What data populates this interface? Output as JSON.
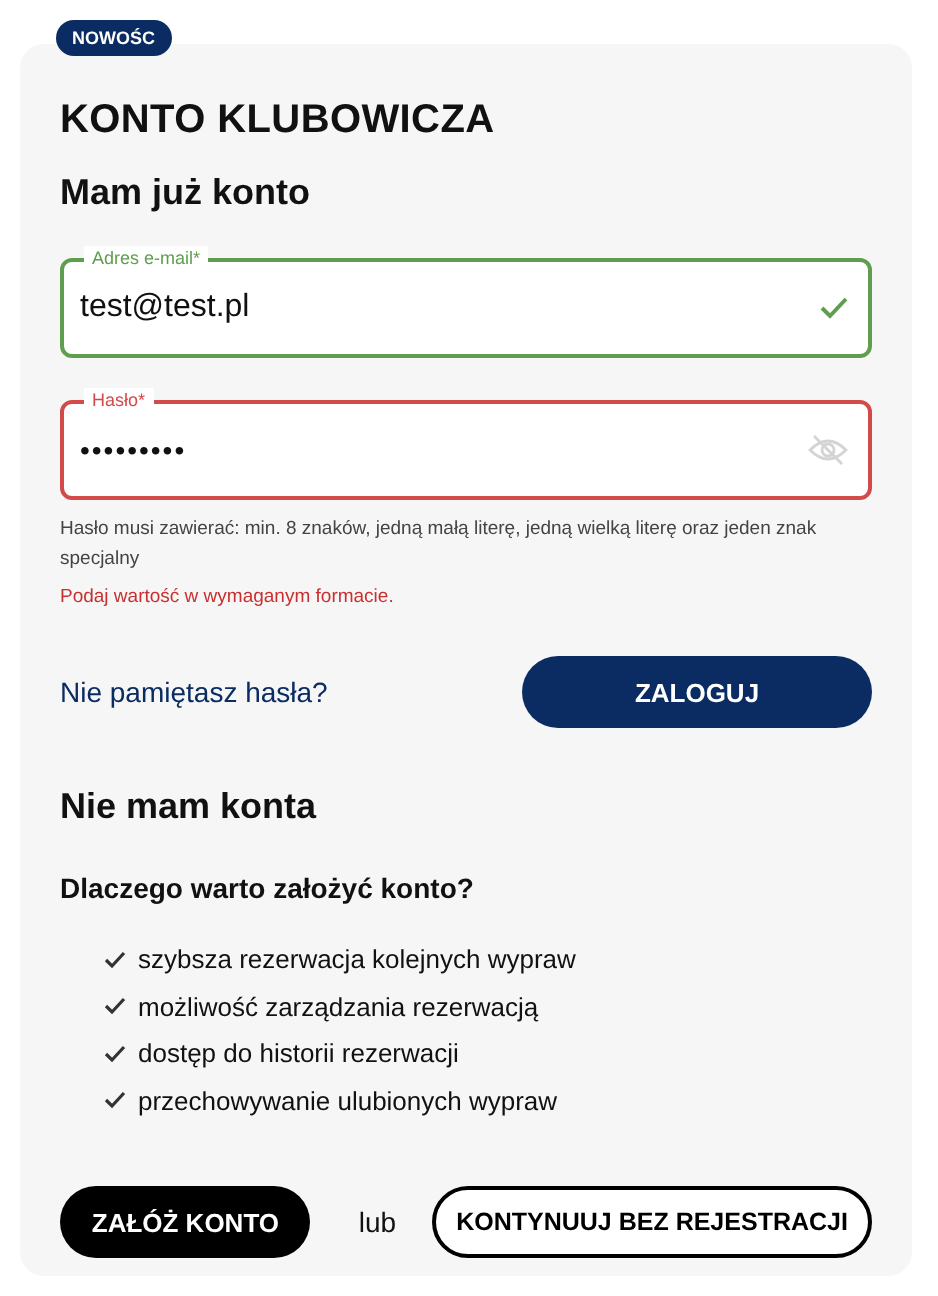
{
  "badge": "NOWOŚC",
  "title": "KONTO KLUBOWICZA",
  "login": {
    "heading": "Mam już konto",
    "fields": [
      {
        "kind": "email",
        "label": "Adres e-mail*",
        "value": "test@test.pl",
        "valid": true
      },
      {
        "kind": "password",
        "label": "Hasło*",
        "value": "•••••••••",
        "valid": false
      }
    ],
    "hint": "Hasło musi zawierać: min. 8 znaków, jedną małą literę, jedną wielką literę oraz jeden znak specjalny",
    "error": "Podaj wartość w wymaganym formacie.",
    "forgot_link": "Nie pamiętasz hasła?",
    "submit": "ZALOGUJ"
  },
  "register": {
    "heading": "Nie mam konta",
    "subheading": "Dlaczego warto założyć konto?",
    "benefits": [
      "szybsza rezerwacja kolejnych wypraw",
      "możliwość zarządzania rezerwacją",
      "dostęp do historii rezerwacji",
      "przechowywanie ulubionych wypraw"
    ],
    "create_button": "ZAŁÓŻ KONTO",
    "or": "lub",
    "guest_button": "KONTYNUUJ BEZ REJESTRACJI"
  }
}
